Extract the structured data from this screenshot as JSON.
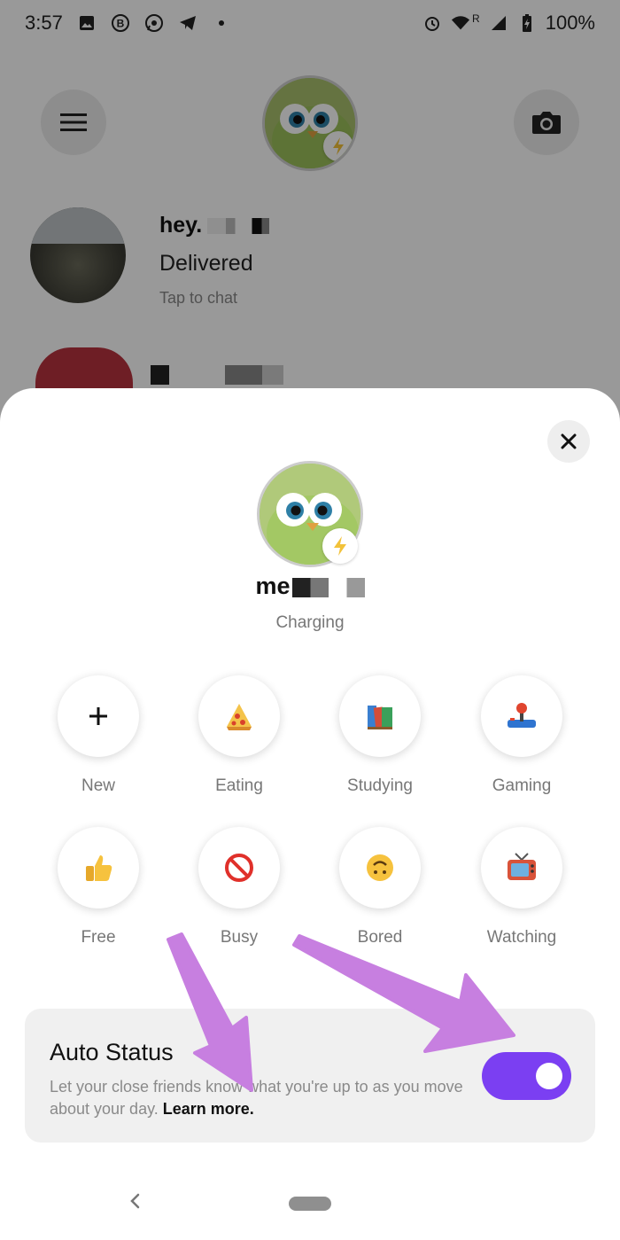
{
  "status_bar": {
    "time": "3:57",
    "battery": "100%",
    "roaming": "R",
    "icons": [
      "image-icon",
      "b-icon",
      "whatsapp-icon",
      "telegram-icon",
      "dot-icon",
      "alarm-icon",
      "wifi-icon",
      "signal-icon",
      "battery-icon"
    ]
  },
  "background": {
    "chat": {
      "name": "hey.",
      "message": "Delivered",
      "hint": "Tap to chat"
    }
  },
  "sheet": {
    "name": "me",
    "status": "Charging",
    "statuses": [
      {
        "label": "New",
        "icon": "plus-icon"
      },
      {
        "label": "Eating",
        "icon": "pizza-icon"
      },
      {
        "label": "Studying",
        "icon": "books-icon"
      },
      {
        "label": "Gaming",
        "icon": "joystick-icon"
      },
      {
        "label": "Free",
        "icon": "thumbs-up-icon"
      },
      {
        "label": "Busy",
        "icon": "no-entry-icon"
      },
      {
        "label": "Bored",
        "icon": "upside-down-face-icon"
      },
      {
        "label": "Watching",
        "icon": "tv-icon"
      }
    ],
    "auto_status": {
      "title": "Auto Status",
      "description": "Let your close friends know what you're up to as you move about your day.",
      "learn_more": "Learn more.",
      "enabled": true
    }
  },
  "colors": {
    "toggle": "#7b3ff2",
    "annotation_arrow": "#c77fe0"
  }
}
